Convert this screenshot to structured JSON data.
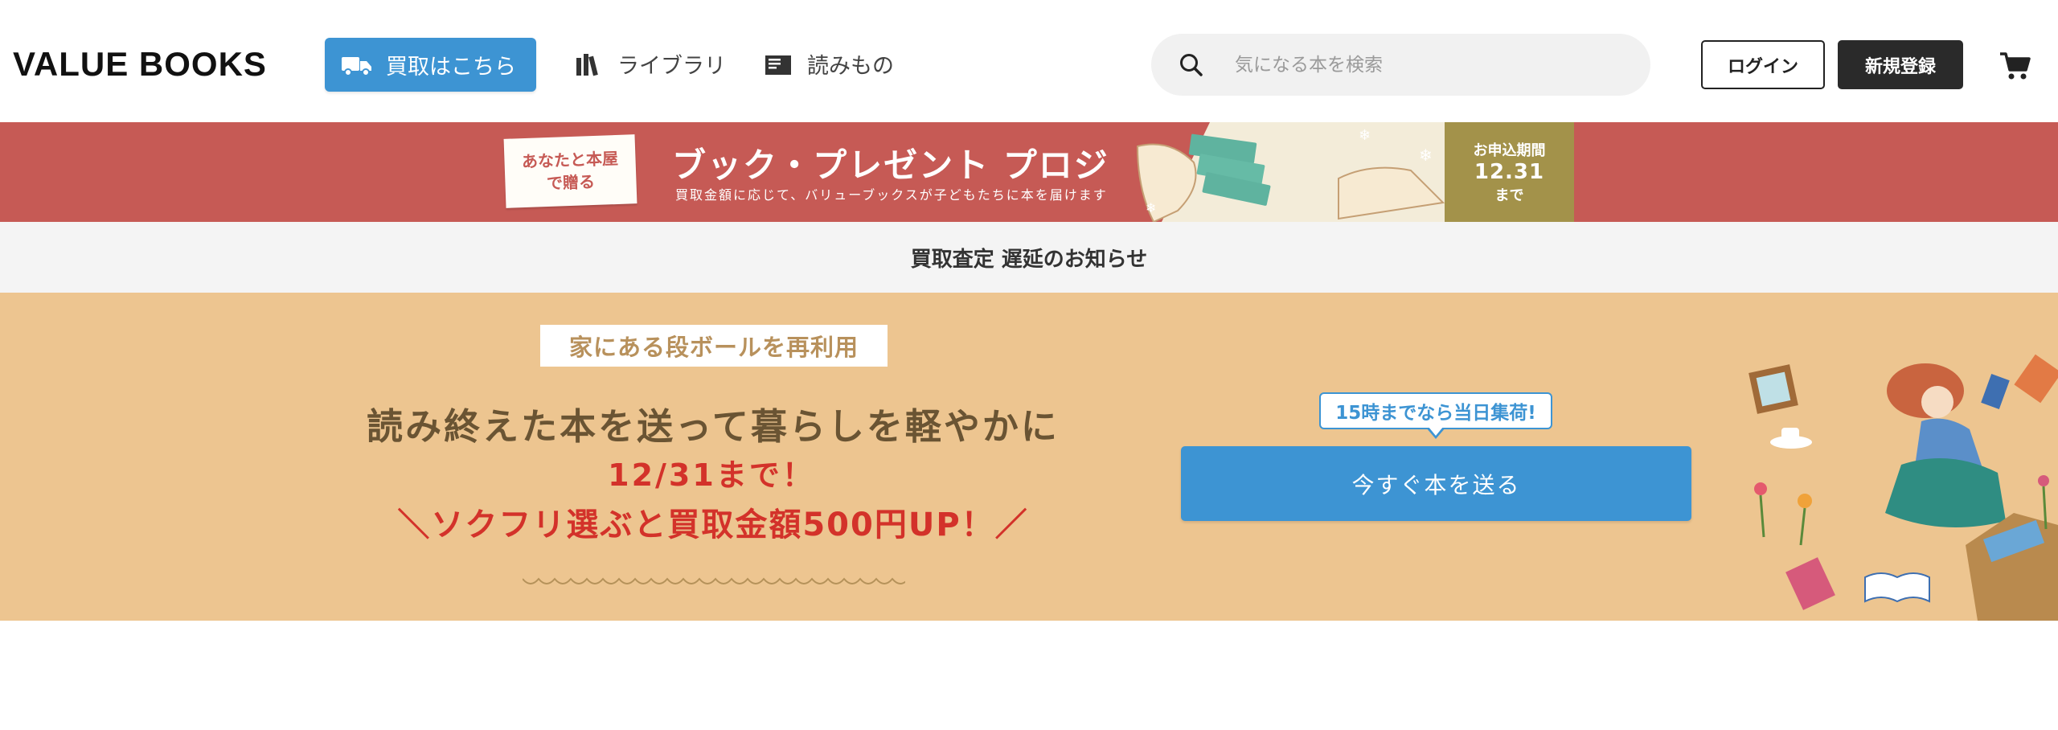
{
  "header": {
    "logo": "VALUE BOOKS",
    "buy_button": "買取はこちら",
    "nav": [
      {
        "label": "ライブラリ",
        "icon": "library-icon"
      },
      {
        "label": "読みもの",
        "icon": "article-icon"
      }
    ],
    "search": {
      "placeholder": "気になる本を検索",
      "value": ""
    },
    "login": "ログイン",
    "signup": "新規登録",
    "cart_icon": "cart-icon"
  },
  "campaign": {
    "tag_line1": "あなたと本屋",
    "tag_line2": "で贈る",
    "title": "ブック・プレゼント プロジェクト",
    "subtitle": "買取金額に応じて、バリューブックスが子どもたちに本を届けます",
    "deadline_label": "お申込期間",
    "deadline_date": "12.31",
    "deadline_suffix": "まで",
    "colors": {
      "background": "#c65a55",
      "deadline_bg": "#a3924a"
    }
  },
  "notice": {
    "text": "買取査定 遅延のお知らせ"
  },
  "hero": {
    "label": "家にある段ボールを再利用",
    "heading": "読み終えた本を送って暮らしを軽やかに",
    "deadline": "12/31まで！",
    "promo": "＼ソクフリ選ぶと買取金額500円UP！／",
    "bubble": "15時までなら当日集荷!",
    "cta": "今すぐ本を送る",
    "colors": {
      "background": "#edc590",
      "accent": "#3d94d3",
      "promo": "#d3322a"
    }
  }
}
